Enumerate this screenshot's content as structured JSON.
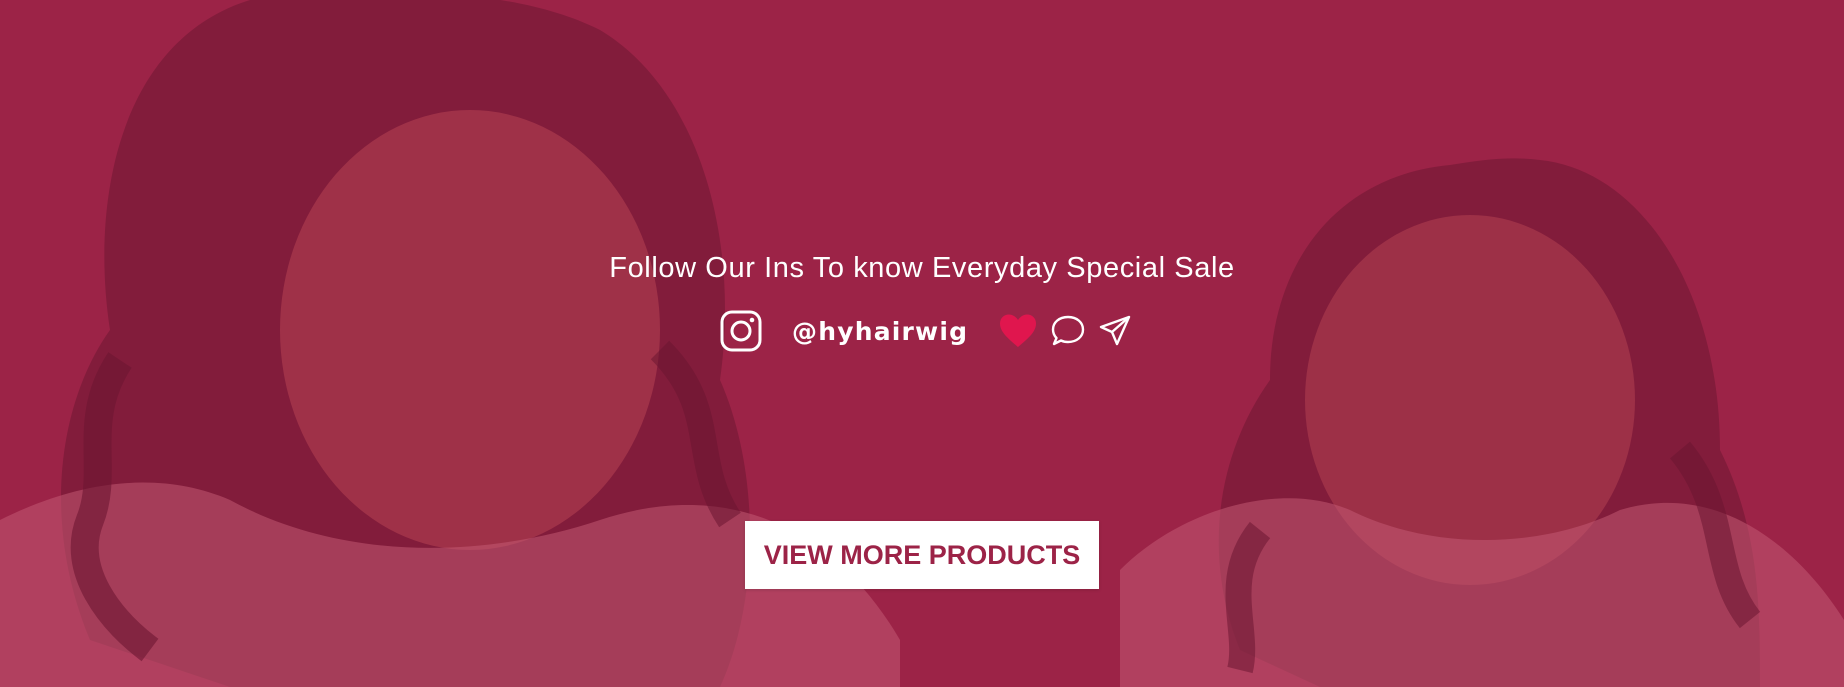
{
  "banner": {
    "headline": "Follow Our Ins To know Everyday Special Sale",
    "handle": "@hyhairwig",
    "cta_label": "VIEW MORE PRODUCTS",
    "icons": {
      "instagram": "instagram-icon",
      "like": "heart-icon",
      "comment": "comment-icon",
      "share": "send-icon"
    },
    "colors": {
      "background": "#9c2347",
      "text": "#ffffff",
      "heart": "#e0164e",
      "button_bg": "#ffffff",
      "button_text": "#9c2347"
    }
  }
}
